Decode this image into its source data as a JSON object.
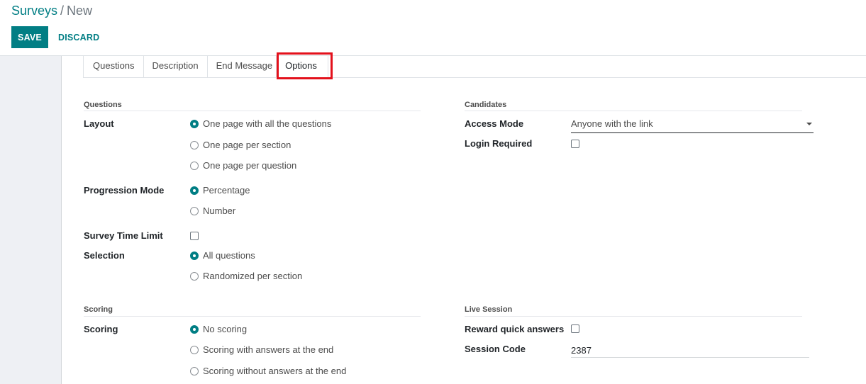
{
  "breadcrumb": {
    "parent": "Surveys",
    "separator": "/",
    "current": "New"
  },
  "buttons": {
    "save": "SAVE",
    "discard": "DISCARD"
  },
  "tabs": [
    {
      "label": "Questions",
      "active": false
    },
    {
      "label": "Description",
      "active": false
    },
    {
      "label": "End Message",
      "active": false
    },
    {
      "label": "Options",
      "active": true
    }
  ],
  "questions_section": {
    "title": "Questions",
    "layout": {
      "label": "Layout",
      "options": [
        "One page with all the questions",
        "One page per section",
        "One page per question"
      ],
      "selected": 0
    },
    "progression_mode": {
      "label": "Progression Mode",
      "options": [
        "Percentage",
        "Number"
      ],
      "selected": 0
    },
    "time_limit": {
      "label": "Survey Time Limit",
      "checked": false
    },
    "selection": {
      "label": "Selection",
      "options": [
        "All questions",
        "Randomized per section"
      ],
      "selected": 0
    }
  },
  "candidates_section": {
    "title": "Candidates",
    "access_mode": {
      "label": "Access Mode",
      "value": "Anyone with the link"
    },
    "login_required": {
      "label": "Login Required",
      "checked": false
    }
  },
  "scoring_section": {
    "title": "Scoring",
    "scoring": {
      "label": "Scoring",
      "options": [
        "No scoring",
        "Scoring with answers at the end",
        "Scoring without answers at the end"
      ],
      "selected": 0
    }
  },
  "live_session_section": {
    "title": "Live Session",
    "reward_quick_answers": {
      "label": "Reward quick answers",
      "checked": false
    },
    "session_code": {
      "label": "Session Code",
      "value": "2387"
    }
  },
  "colors": {
    "accent": "#017e84",
    "highlight": "#e3111c"
  }
}
